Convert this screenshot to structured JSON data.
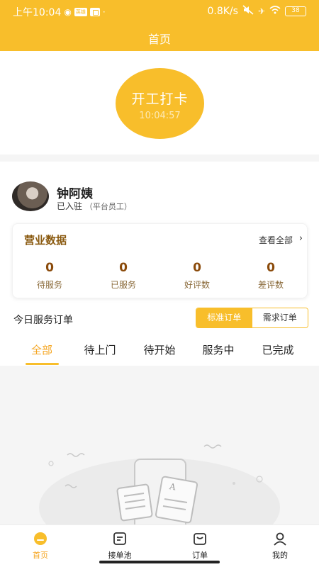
{
  "status_bar": {
    "time": "上午10:04",
    "network_speed": "0.8K/s",
    "battery": "38",
    "icons": [
      "qq-icon",
      "app-badge-icon",
      "notification-icon",
      "mute-icon",
      "airplane-icon",
      "wifi-icon",
      "battery-icon"
    ],
    "chip_text": "英雄"
  },
  "header": {
    "title": "首页",
    "accent_color": "#F8BE2B"
  },
  "clock_in": {
    "label": "开工打卡",
    "time": "10:04:57"
  },
  "profile": {
    "name": "钟阿姨",
    "status": "已入驻",
    "note": "（平台员工）"
  },
  "business": {
    "title": "营业数据",
    "view_all": "查看全部",
    "stats": [
      {
        "value": "0",
        "label": "待服务"
      },
      {
        "value": "0",
        "label": "已服务"
      },
      {
        "value": "0",
        "label": "好评数"
      },
      {
        "value": "0",
        "label": "差评数"
      }
    ]
  },
  "orders": {
    "title": "今日服务订单",
    "segments": [
      "标准订单",
      "需求订单"
    ],
    "selected_segment": "标准订单",
    "tabs": [
      "全部",
      "待上门",
      "待开始",
      "服务中",
      "已完成"
    ],
    "selected_tab": "全部"
  },
  "bottom_nav": {
    "items": [
      {
        "label": "首页",
        "icon": "home-icon",
        "active": true
      },
      {
        "label": "接单池",
        "icon": "order-pool-icon",
        "active": false
      },
      {
        "label": "订单",
        "icon": "orders-icon",
        "active": false
      },
      {
        "label": "我的",
        "icon": "profile-icon",
        "active": false
      }
    ]
  }
}
